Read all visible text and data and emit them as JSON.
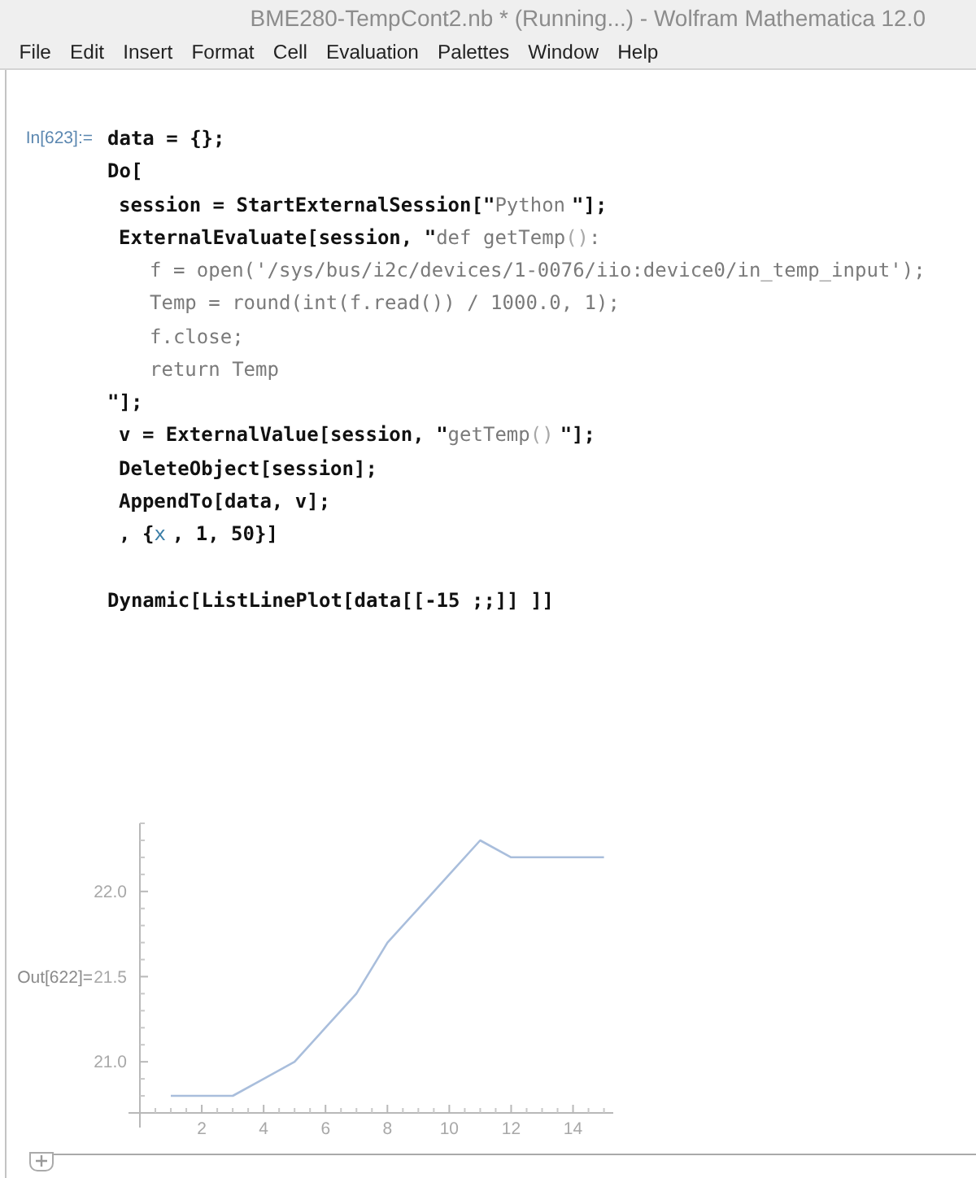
{
  "window": {
    "title": "BME280-TempCont2.nb * (Running...) - Wolfram Mathematica 12.0"
  },
  "menu_bar": [
    {
      "label": "File"
    },
    {
      "label": "Edit"
    },
    {
      "label": "Insert"
    },
    {
      "label": "Format"
    },
    {
      "label": "Cell"
    },
    {
      "label": "Evaluation"
    },
    {
      "label": "Palettes"
    },
    {
      "label": "Window"
    },
    {
      "label": "Help"
    }
  ],
  "input_cell": {
    "label": "In[623]:=",
    "blocks": [
      {
        "lines": [
          {
            "segments": [
              {
                "kind": "code",
                "text": "data = {};"
              }
            ]
          },
          {
            "segments": [
              {
                "kind": "code",
                "text": "Do["
              }
            ],
            "children": [
              {
                "segments": [
                  {
                    "kind": "code",
                    "text": "session = StartExternalSession[\""
                  },
                  {
                    "kind": "string",
                    "text": "Python"
                  },
                  {
                    "kind": "code",
                    "text": "\"];"
                  }
                ]
              },
              {
                "segments": [
                  {
                    "kind": "code",
                    "text": "ExternalEvaluate[session, \""
                  },
                  {
                    "kind": "string",
                    "text": "def getTemp"
                  },
                  {
                    "kind": "faint",
                    "text": "()"
                  },
                  {
                    "kind": "string",
                    "text": ":"
                  }
                ],
                "children": [
                  {
                    "segments": [
                      {
                        "kind": "string",
                        "text": "f = open('/sys/bus/i2c/devices/1-0076/iio:device0/in_temp_input');"
                      }
                    ]
                  },
                  {
                    "segments": [
                      {
                        "kind": "string",
                        "text": "Temp = round(int(f.read()) / 1000.0, 1);"
                      }
                    ]
                  },
                  {
                    "segments": [
                      {
                        "kind": "string",
                        "text": "f.close;"
                      }
                    ]
                  },
                  {
                    "segments": [
                      {
                        "kind": "string",
                        "text": "return Temp"
                      }
                    ]
                  }
                ]
              }
            ]
          },
          {
            "segments": [
              {
                "kind": "code",
                "text": "\"];"
              }
            ],
            "children": [
              {
                "segments": [
                  {
                    "kind": "code",
                    "text": "v = ExternalValue[session, \""
                  },
                  {
                    "kind": "string",
                    "text": "getTemp"
                  },
                  {
                    "kind": "faint",
                    "text": "()"
                  },
                  {
                    "kind": "code",
                    "text": "\"];"
                  }
                ]
              },
              {
                "segments": [
                  {
                    "kind": "code",
                    "text": "DeleteObject[session];"
                  }
                ]
              },
              {
                "segments": [
                  {
                    "kind": "code",
                    "text": "AppendTo[data, v];"
                  }
                ]
              },
              {
                "segments": [
                  {
                    "kind": "code",
                    "text": ", {"
                  },
                  {
                    "kind": "variable",
                    "text": "x"
                  },
                  {
                    "kind": "code",
                    "text": ", 1, 50}]"
                  }
                ]
              }
            ]
          }
        ]
      },
      {
        "lines": [
          {
            "segments": [
              {
                "kind": "code",
                "text": "Dynamic[ListLinePlot[data[[-15 ;;]] ]]"
              }
            ]
          }
        ]
      }
    ]
  },
  "output_cell": {
    "label": "Out[622]=",
    "chart_data": {
      "type": "line",
      "x": [
        1,
        2,
        3,
        4,
        5,
        6,
        7,
        8,
        9,
        10,
        11,
        12,
        13,
        14,
        15
      ],
      "values": [
        20.8,
        20.8,
        20.8,
        20.9,
        21.0,
        21.2,
        21.4,
        21.7,
        21.9,
        22.1,
        22.3,
        22.2,
        22.2,
        22.2,
        22.2
      ],
      "xlim": [
        0,
        15.3
      ],
      "ylim": [
        20.7,
        22.4
      ],
      "xticks": [
        2,
        4,
        6,
        8,
        10,
        12,
        14
      ],
      "yticks": [
        {
          "value": 21,
          "label": "21.0"
        },
        {
          "value": 21.5,
          "label": "21.5"
        },
        {
          "value": 22,
          "label": "22.0"
        }
      ]
    }
  }
}
